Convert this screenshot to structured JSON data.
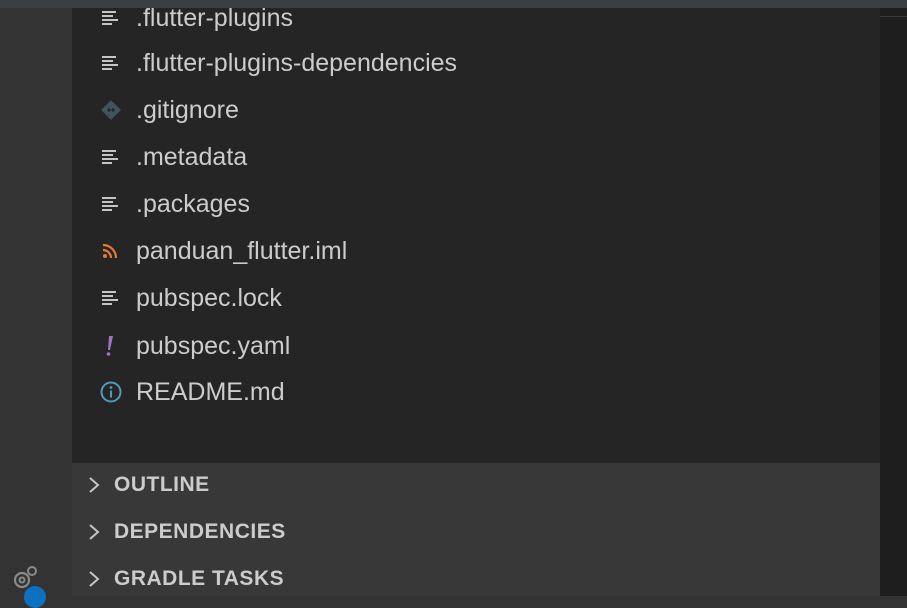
{
  "explorer": {
    "files": [
      {
        "name": ".flutter-plugins",
        "icon": "text-lines-icon"
      },
      {
        "name": ".flutter-plugins-dependencies",
        "icon": "text-lines-icon"
      },
      {
        "name": ".gitignore",
        "icon": "git-diamond-icon",
        "color": "#41535b"
      },
      {
        "name": ".metadata",
        "icon": "text-lines-icon"
      },
      {
        "name": ".packages",
        "icon": "text-lines-icon"
      },
      {
        "name": "panduan_flutter.iml",
        "icon": "rss-icon",
        "color": "#e37933"
      },
      {
        "name": "pubspec.lock",
        "icon": "text-lines-icon"
      },
      {
        "name": "pubspec.yaml",
        "icon": "exclamation-icon",
        "color": "#a074c4"
      },
      {
        "name": "README.md",
        "icon": "info-circle-icon",
        "color": "#519aba"
      }
    ]
  },
  "sections": [
    {
      "label": "OUTLINE",
      "icon": "chevron-right-icon"
    },
    {
      "label": "DEPENDENCIES",
      "icon": "chevron-right-icon"
    },
    {
      "label": "GRADLE TASKS",
      "icon": "chevron-right-icon"
    }
  ],
  "activity": {
    "manage_icon": "gear-icon",
    "accent": "#0e70c0"
  }
}
